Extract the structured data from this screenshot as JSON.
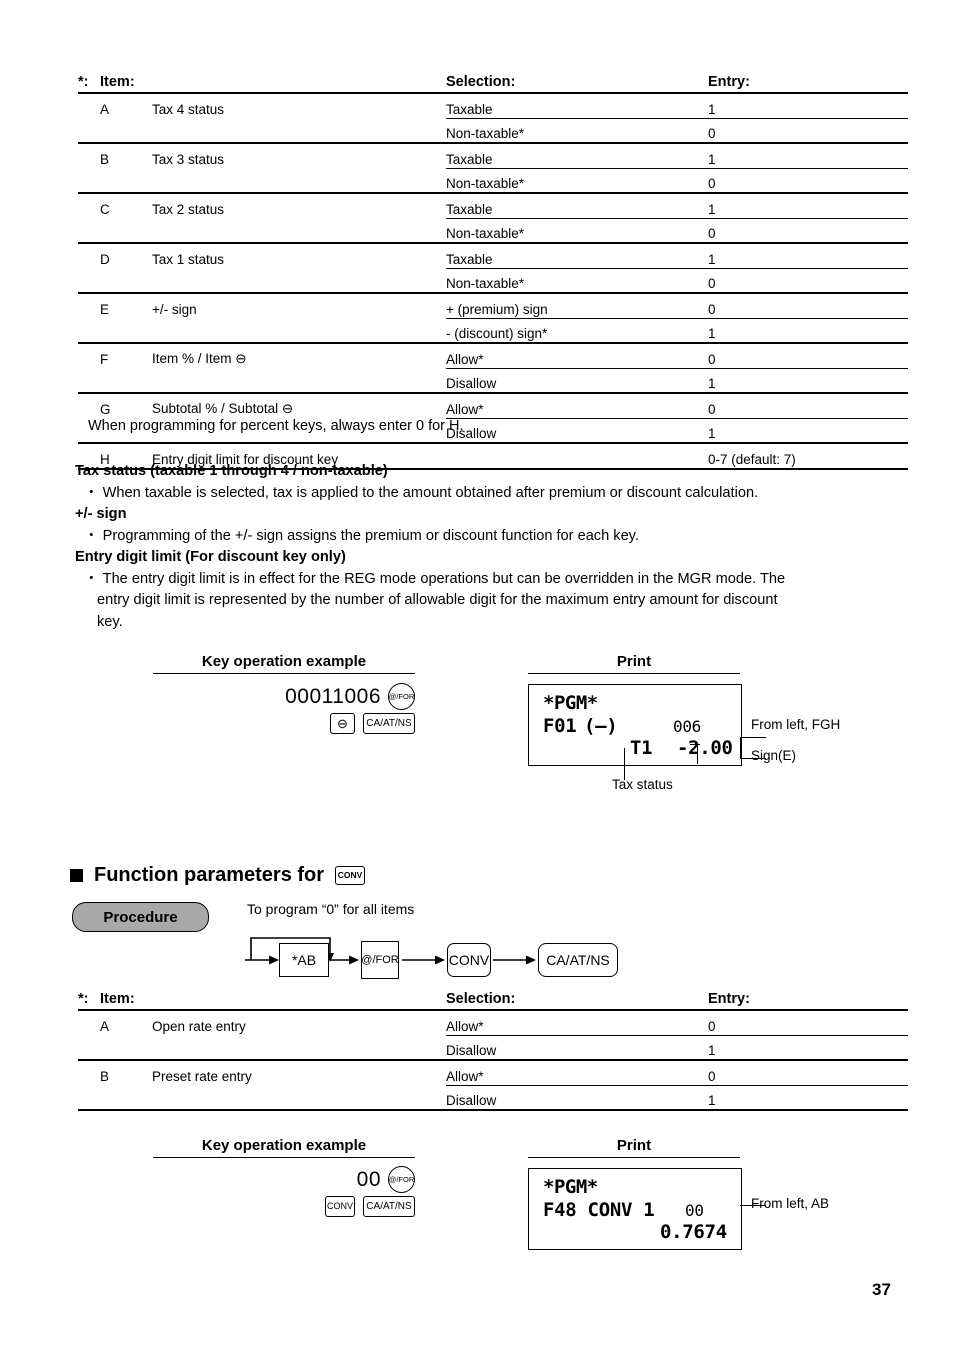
{
  "table1": {
    "headers": {
      "star": "*:",
      "item": "Item:",
      "selection": "Selection:",
      "entry": "Entry:"
    },
    "rows": [
      {
        "letter": "A",
        "item": "Tax 4 status",
        "selections": [
          {
            "selection": "Taxable",
            "entry": "1"
          },
          {
            "selection": "Non-taxable*",
            "entry": "0"
          }
        ]
      },
      {
        "letter": "B",
        "item": "Tax 3 status",
        "selections": [
          {
            "selection": "Taxable",
            "entry": "1"
          },
          {
            "selection": "Non-taxable*",
            "entry": "0"
          }
        ]
      },
      {
        "letter": "C",
        "item": "Tax 2 status",
        "selections": [
          {
            "selection": "Taxable",
            "entry": "1"
          },
          {
            "selection": "Non-taxable*",
            "entry": "0"
          }
        ]
      },
      {
        "letter": "D",
        "item": "Tax 1 status",
        "selections": [
          {
            "selection": "Taxable",
            "entry": "1"
          },
          {
            "selection": "Non-taxable*",
            "entry": "0"
          }
        ]
      },
      {
        "letter": "E",
        "item": "+/- sign",
        "selections": [
          {
            "selection": "+ (premium) sign",
            "entry": "0"
          },
          {
            "selection": "- (discount) sign*",
            "entry": "1"
          }
        ]
      },
      {
        "letter": "F",
        "item": "Item % / Item ⊖",
        "selections": [
          {
            "selection": "Allow*",
            "entry": "0"
          },
          {
            "selection": "Disallow",
            "entry": "1"
          }
        ]
      },
      {
        "letter": "G",
        "item": "Subtotal % / Subtotal ⊖",
        "selections": [
          {
            "selection": "Allow*",
            "entry": "0"
          },
          {
            "selection": "Disallow",
            "entry": "1"
          }
        ]
      }
    ],
    "row_h": {
      "letter": "H",
      "item": "Entry digit limit for discount key",
      "entry": "0-7 (default: 7)"
    },
    "footnote": "When programming for percent keys, always enter 0 for H."
  },
  "prose": {
    "h1": "Tax status (taxable 1 through 4 / non-taxable)",
    "b1": "・ When taxable is selected, tax is applied to the amount obtained after premium or discount calculation.",
    "h2": "+/- sign",
    "b2": "・ Programming of the +/- sign assigns the premium or discount function for each key.",
    "h3": "Entry digit limit (For discount key only)",
    "b3a": "・ The entry digit limit is in effect for the REG mode operations but can be overridden in the MGR mode.  The",
    "b3b": "entry digit limit is represented by the number of allowable digit for the maximum entry amount for discount",
    "b3c": "key."
  },
  "example1": {
    "title": "Key operation example",
    "number": "00011006",
    "key_for": "@/FOR",
    "key_minus": "⊖",
    "key_caatns": "CA/AT/NS"
  },
  "print1": {
    "title": "Print",
    "pgm": "*PGM*",
    "line2_left": "F01",
    "line2_paren": "(—)",
    "line2_right": "006",
    "line3_left": "T1",
    "line3_right": "-2.00",
    "callout_top": "From left, FGH",
    "callout_bottom": "Sign(E)",
    "callout_below": "Tax status"
  },
  "section2": {
    "heading": "Function parameters for",
    "heading_key": "CONV"
  },
  "procedure": {
    "badge": "Procedure",
    "note": "To program “0” for all items",
    "steps": [
      {
        "label": "*AB",
        "shape": "box"
      },
      {
        "label": "@/FOR",
        "shape": "circle"
      },
      {
        "label": "CONV",
        "shape": "rounded"
      },
      {
        "label": "CA/AT/NS",
        "shape": "rounded"
      }
    ]
  },
  "table2": {
    "headers": {
      "star": "*:",
      "item": "Item:",
      "selection": "Selection:",
      "entry": "Entry:"
    },
    "rows": [
      {
        "letter": "A",
        "item": "Open rate entry",
        "selections": [
          {
            "selection": "Allow*",
            "entry": "0"
          },
          {
            "selection": "Disallow",
            "entry": "1"
          }
        ]
      },
      {
        "letter": "B",
        "item": "Preset rate entry",
        "selections": [
          {
            "selection": "Allow*",
            "entry": "0"
          },
          {
            "selection": "Disallow",
            "entry": "1"
          }
        ]
      }
    ]
  },
  "example2": {
    "title": "Key operation example",
    "number": "00",
    "key_for": "@/FOR",
    "key_conv": "CONV",
    "key_caatns": "CA/AT/NS"
  },
  "print2": {
    "title": "Print",
    "pgm": "*PGM*",
    "line2_left": "F48 CONV 1",
    "line2_right": "00",
    "line3_right": "0.7674",
    "callout_top": "From left, AB"
  },
  "page_number": "37"
}
